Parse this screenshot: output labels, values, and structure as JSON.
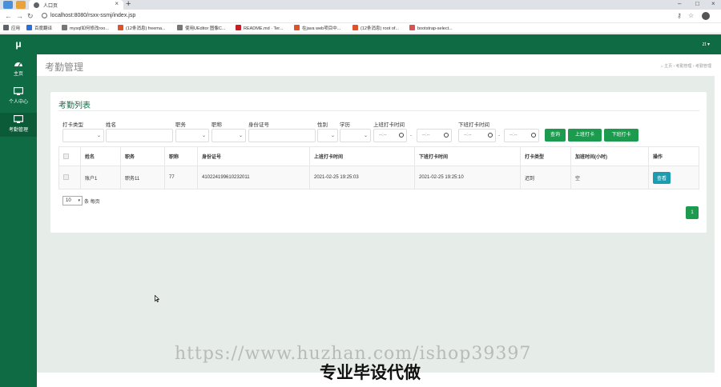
{
  "browser": {
    "tab_title": "人口页",
    "url": "localhost:8080/rsxx-ssmj/index.jsp",
    "bookmarks": [
      {
        "label": "应用",
        "color": "#5f6368"
      },
      {
        "label": "百度翻译",
        "color": "#2a6fdb"
      },
      {
        "label": "mysql如何修改roo...",
        "color": "#777777"
      },
      {
        "label": "(12条消息) freema...",
        "color": "#e0522a"
      },
      {
        "label": "使用UEditor 图像C...",
        "color": "#777777"
      },
      {
        "label": "README.md · Ter...",
        "color": "#c71d23"
      },
      {
        "label": "在java web项目中...",
        "color": "#e0522a"
      },
      {
        "label": "(12条消息) root of...",
        "color": "#e0522a"
      },
      {
        "label": "bootstrap-select...",
        "color": "#d9534f"
      }
    ]
  },
  "sidebar": {
    "logo": "μ",
    "items": [
      {
        "label": "主页",
        "icon": "dashboard-icon"
      },
      {
        "label": "个人中心",
        "icon": "monitor-icon"
      },
      {
        "label": "考勤管理",
        "icon": "monitor-icon"
      }
    ]
  },
  "topbar": {
    "user": "zt ▾"
  },
  "header": {
    "title": "考勤管理",
    "breadcrumb": "⌂ 主页  ›  考勤管理  ›  考勤管理"
  },
  "card": {
    "title": "考勤列表"
  },
  "filters": {
    "punch_type": "打卡类型",
    "name": "姓名",
    "position": "职务",
    "rank": "职称",
    "id_number": "身份证号",
    "gender": "性别",
    "education": "学历",
    "clock_in_time": "上班打卡时间",
    "clock_out_time": "下班打卡时间",
    "time_placeholder": "--:--",
    "range_dash": "-"
  },
  "buttons": {
    "search": "查询",
    "clock_in": "上班打卡",
    "clock_out": "下班打卡"
  },
  "table": {
    "headers": [
      "姓名",
      "职务",
      "职称",
      "身份证号",
      "上班打卡时间",
      "下班打卡时间",
      "打卡类型",
      "加班时间(小时)",
      "操作"
    ],
    "rows": [
      {
        "name": "账户1",
        "position": "职务11",
        "rank": "77",
        "id_number": "410224199610232011",
        "clock_in": "2021-02-25 19:25:03",
        "clock_out": "2021-02-25 19:25:10",
        "type": "迟到",
        "overtime": "空",
        "action": "查看"
      }
    ]
  },
  "pager": {
    "page_size": "10",
    "per_page_text": "条 每页",
    "current_page": "1"
  },
  "overlay": {
    "watermark": "https://www.huzhan.com/ishop39397",
    "caption": "专业毕设代做"
  }
}
